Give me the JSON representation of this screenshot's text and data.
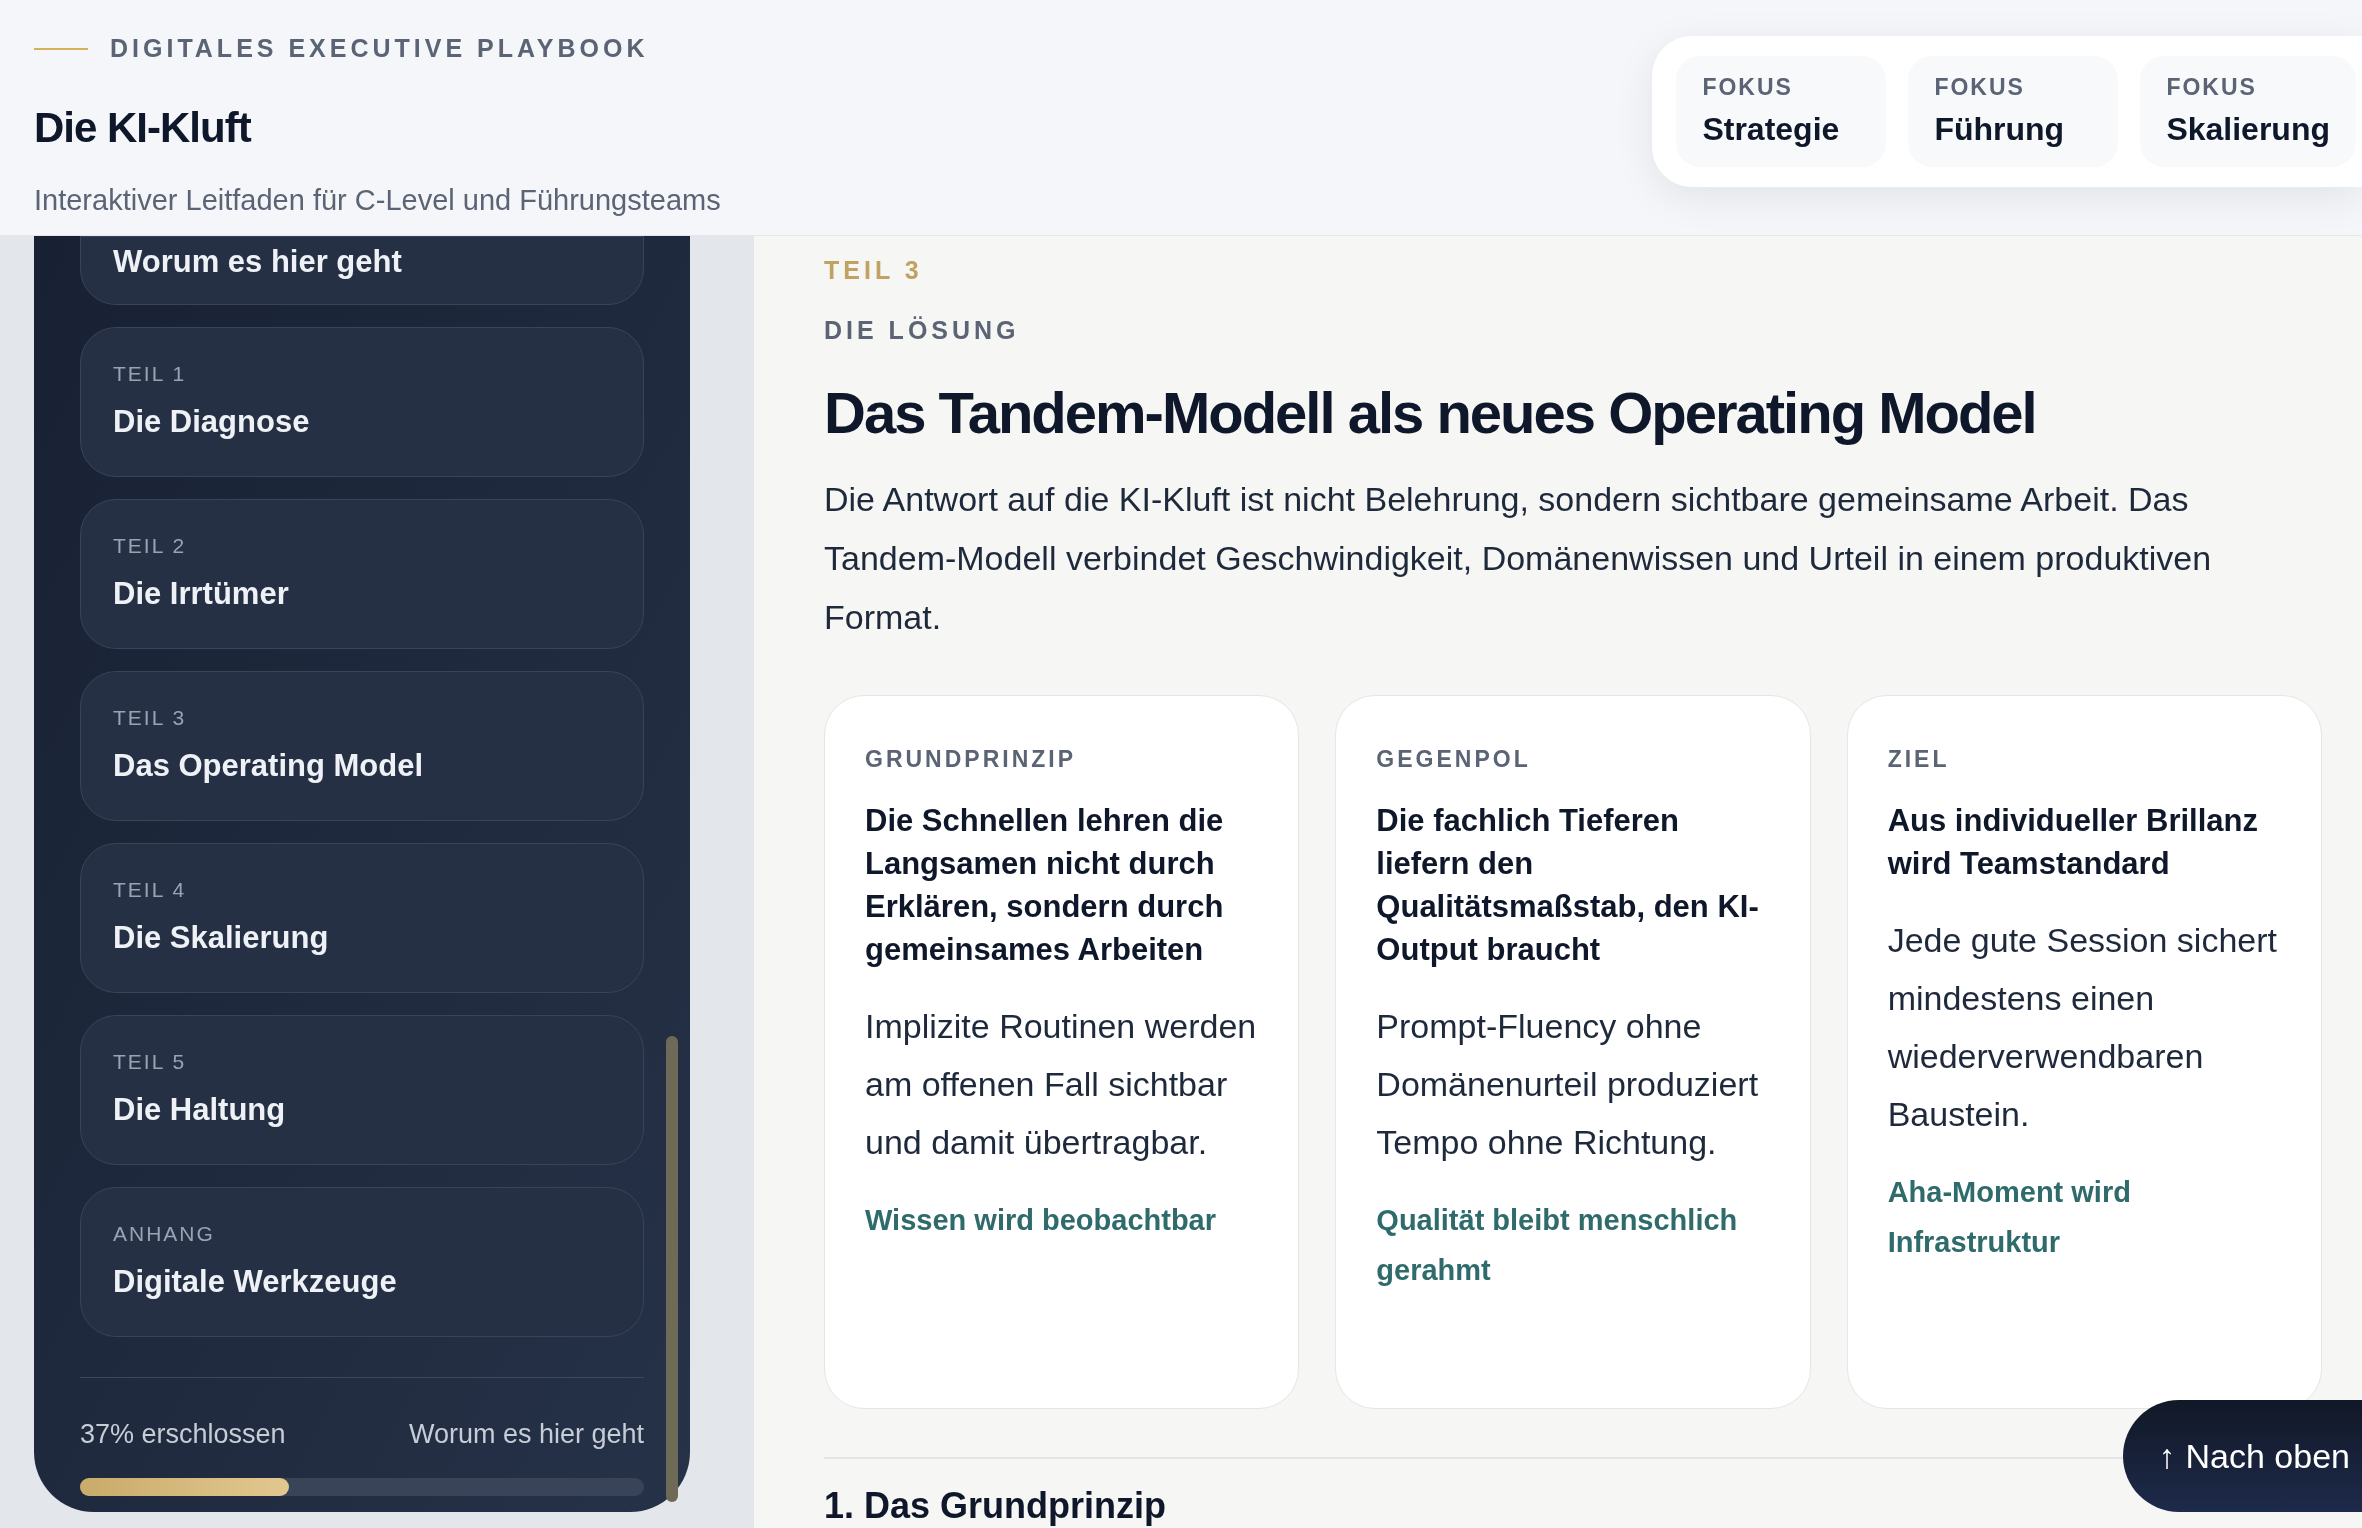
{
  "header": {
    "eyebrow": "DIGITALES EXECUTIVE PLAYBOOK",
    "title": "Die KI-Kluft",
    "subtitle": "Interaktiver Leitfaden für C-Level und Führungsteams",
    "focus": [
      {
        "label": "FOKUS",
        "value": "Strategie"
      },
      {
        "label": "FOKUS",
        "value": "Führung"
      },
      {
        "label": "FOKUS",
        "value": "Skalierung"
      }
    ]
  },
  "sidebar": {
    "items": [
      {
        "title": "Worum es hier geht"
      },
      {
        "label": "TEIL 1",
        "title": "Die Diagnose"
      },
      {
        "label": "TEIL 2",
        "title": "Die Irrtümer"
      },
      {
        "label": "TEIL 3",
        "title": "Das Operating Model"
      },
      {
        "label": "TEIL 4",
        "title": "Die Skalierung"
      },
      {
        "label": "TEIL 5",
        "title": "Die Haltung"
      },
      {
        "label": "ANHANG",
        "title": "Digitale Werkzeuge"
      }
    ],
    "progress": {
      "text": "37% erschlossen",
      "current": "Worum es hier geht",
      "level": 0.37
    }
  },
  "main": {
    "part": "TEIL 3",
    "kicker": "DIE LÖSUNG",
    "title": "Das Tandem-Modell als neues Operating Model",
    "intro": "Die Antwort auf die KI-Kluft ist nicht Belehrung, sondern sichtbare gemeinsame Arbeit. Das Tandem-Modell verbindet Geschwindigkeit, Domänenwissen und Urteil in einem produktiven Format.",
    "cards": [
      {
        "label": "GRUNDPRINZIP",
        "heading": "Die Schnellen lehren die Langsamen nicht durch Erklären, sondern durch gemeinsames Arbeiten",
        "body": "Implizite Routinen werden am offenen Fall sichtbar und damit übertragbar.",
        "result": "Wissen wird beobachtbar"
      },
      {
        "label": "GEGENPOL",
        "heading": "Die fachlich Tieferen liefern den Qualitätsmaßstab, den KI-Output braucht",
        "body": "Prompt-Fluency ohne Domänenurteil produziert Tempo ohne Richtung.",
        "result": "Qualität bleibt menschlich gerahmt"
      },
      {
        "label": "ZIEL",
        "heading": "Aus individueller Brillanz wird Teamstandard",
        "body": "Jede gute Session sichert mindestens einen wiederverwendbaren Baustein.",
        "result": "Aha-Moment wird Infrastruktur"
      }
    ],
    "next_heading": "1. Das Grundprinzip"
  },
  "back_to_top": {
    "arrow": "↑",
    "label": "Nach oben"
  }
}
